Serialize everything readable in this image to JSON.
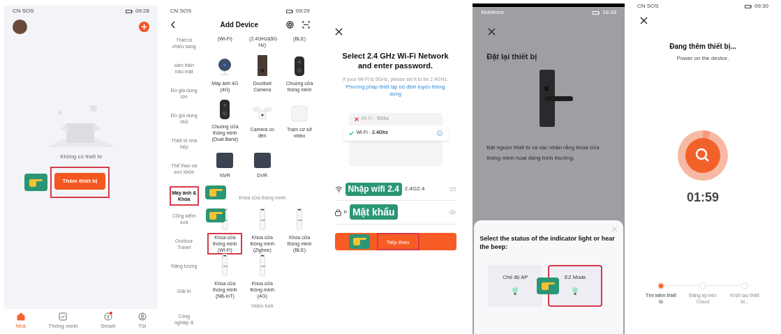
{
  "home": {
    "status": {
      "carrier": "CN SOS",
      "time": "09:28"
    },
    "empty_text": "Không có thiết bị",
    "add_button": {
      "label": "Thêm thiết bị",
      "highlighted": true
    },
    "nav": [
      {
        "label": "Nhà",
        "selected": true,
        "kind": "home",
        "dot": false
      },
      {
        "label": "Thông minh",
        "selected": false,
        "kind": "check",
        "dot": false
      },
      {
        "label": "Smart",
        "selected": false,
        "kind": "smart",
        "dot": true
      },
      {
        "label": "Tôi",
        "selected": false,
        "kind": "user",
        "dot": false
      }
    ]
  },
  "add_device": {
    "status": {
      "carrier": "CN SOS",
      "time": "09:29"
    },
    "title": "Add Device",
    "categories": [
      {
        "label": "Thiết bị chiếu sáng",
        "selected": false
      },
      {
        "label": "cảm biến bảo mật",
        "selected": false
      },
      {
        "label": "Đồ gia dụng lớn",
        "selected": false
      },
      {
        "label": "Đồ gia dụng nhỏ",
        "selected": false
      },
      {
        "label": "Thiết bị nhà bếp",
        "selected": false
      },
      {
        "label": "Thể thao và sức khỏe",
        "selected": false
      },
      {
        "label": "Máy ảnh & Khóa",
        "selected": true
      },
      {
        "label": "Cổng kiểm soá",
        "selected": false
      },
      {
        "label": "Outdoor Travel",
        "selected": false
      },
      {
        "label": "Năng lượng",
        "selected": false
      },
      {
        "label": "Giải trí",
        "selected": false
      },
      {
        "label": "Công nghiệp &",
        "selected": false
      }
    ],
    "cut_row": [
      "(Wi-Fi)",
      "(2.4GHz&5G Hz)",
      "(BLE)"
    ],
    "devices": [
      {
        "name": "Máy ảnh 4G (4G)",
        "kind": "camera",
        "highlighted": false
      },
      {
        "name": "Doorbell Camera",
        "kind": "doorbell",
        "highlighted": false
      },
      {
        "name": "Chuông cửa thông minh",
        "kind": "chime",
        "highlighted": false
      },
      {
        "name": "Chuông cửa thông minh (Dual Band)",
        "kind": "chime",
        "highlighted": false
      },
      {
        "name": "Camera có đèn",
        "kind": "floodlight",
        "highlighted": false
      },
      {
        "name": "Trạm cơ sở video",
        "kind": "hub",
        "highlighted": false
      },
      {
        "name": "NVR",
        "kind": "recorder",
        "highlighted": false
      },
      {
        "name": "DVR",
        "kind": "recorder",
        "highlighted": false
      }
    ],
    "lock_section": "Khóa cửa thông minh",
    "locks": [
      {
        "name": "Khóa cửa thông minh (Wi-Fi)",
        "kind": "lock",
        "highlighted": true
      },
      {
        "name": "Khóa cửa thông minh (Zigbee)",
        "kind": "lock",
        "highlighted": false
      },
      {
        "name": "Khóa cửa thông minh (BLE)",
        "kind": "lock",
        "highlighted": false
      },
      {
        "name": "Khóa cửa thông minh (NB-IoT)",
        "kind": "lock",
        "highlighted": false
      },
      {
        "name": "Khóa cửa thông minh (4G)",
        "kind": "lock",
        "highlighted": false
      }
    ],
    "next_section": "Video lock"
  },
  "wifi_setup": {
    "title": "Select 2.4 GHz Wi-Fi Network and enter password.",
    "hint": "If your Wi-Fi is 5GHz, please set it to be 2.4GHz.",
    "link": "Phương pháp thiết lập bộ định tuyến thông dụng",
    "networks": [
      {
        "label": "Wi-Fi - **5Ghz**",
        "ok": false
      },
      {
        "label": "Wi-Fi - **2.4Ghz**",
        "ok": true
      }
    ],
    "wifi_callout": "Nhập wifi 2.4",
    "wifi_value": "2.4G2.4",
    "password_value": "n",
    "password_callout": "Mật khẩu",
    "next_button": {
      "label": "Tiếp theo",
      "highlighted": true
    }
  },
  "reset_device": {
    "status": {
      "carrier": "Mobifone",
      "time": "16:28"
    },
    "title": "Đặt lại thiết bị",
    "description": "Bật nguồn thiết bị và xác nhận rằng khóa cửa thông minh hoạt động bình thường.",
    "sheet_title": "Select the status of the indicator light or hear the beep:",
    "options": [
      {
        "label": "Chế độ AP",
        "highlighted": false
      },
      {
        "label": "EZ Mode",
        "highlighted": true
      }
    ]
  },
  "adding": {
    "status": {
      "carrier": "CN SOS",
      "time": "09:30"
    },
    "title": "Đang thêm thiết bị...",
    "subtitle": "Power on the device.",
    "timer": "01:59",
    "steps": [
      {
        "label": "Tìm kiếm thiết bị",
        "active": true
      },
      {
        "label": "Đăng ký trên Cloud",
        "active": false
      },
      {
        "label": "Khởi tạo thiết bị...",
        "active": false
      }
    ]
  }
}
